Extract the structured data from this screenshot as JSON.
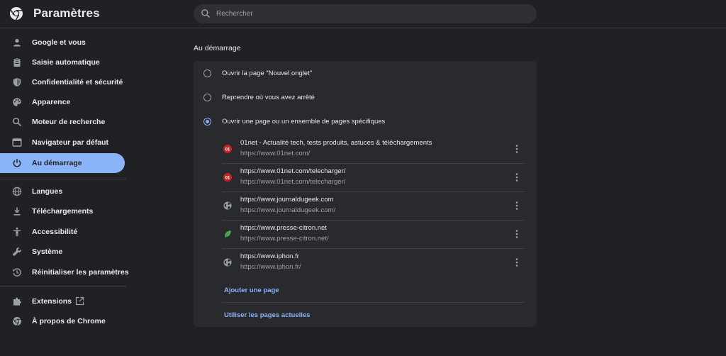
{
  "header": {
    "title": "Paramètres",
    "search_placeholder": "Rechercher"
  },
  "sidebar": {
    "items": [
      {
        "label": "Google et vous",
        "icon": "person-icon"
      },
      {
        "label": "Saisie automatique",
        "icon": "clipboard-icon"
      },
      {
        "label": "Confidentialité et sécurité",
        "icon": "shield-icon"
      },
      {
        "label": "Apparence",
        "icon": "palette-icon"
      },
      {
        "label": "Moteur de recherche",
        "icon": "search-icon"
      },
      {
        "label": "Navigateur par défaut",
        "icon": "browser-icon"
      },
      {
        "label": "Au démarrage",
        "icon": "power-icon",
        "active": true
      },
      {
        "label": "Langues",
        "icon": "globe-icon"
      },
      {
        "label": "Téléchargements",
        "icon": "download-icon"
      },
      {
        "label": "Accessibilité",
        "icon": "accessibility-icon"
      },
      {
        "label": "Système",
        "icon": "wrench-icon"
      },
      {
        "label": "Réinitialiser les paramètres",
        "icon": "restore-icon"
      },
      {
        "label": "Extensions",
        "icon": "puzzle-icon"
      },
      {
        "label": "À propos de Chrome",
        "icon": "chrome-icon"
      }
    ]
  },
  "main": {
    "section_title": "Au démarrage",
    "options": [
      {
        "label": "Ouvrir la page \"Nouvel onglet\"",
        "checked": false
      },
      {
        "label": "Reprendre où vous avez arrêté",
        "checked": false
      },
      {
        "label": "Ouvrir une page ou un ensemble de pages spécifiques",
        "checked": true
      }
    ],
    "pages": [
      {
        "title": "01net - Actualité tech, tests produits, astuces & téléchargements",
        "url": "https://www.01net.com/",
        "favicon": "01net-icon"
      },
      {
        "title": "https://www.01net.com/telecharger/",
        "url": "https://www.01net.com/telecharger/",
        "favicon": "01net-icon"
      },
      {
        "title": "https://www.journaldugeek.com",
        "url": "https://www.journaldugeek.com/",
        "favicon": "globe-icon"
      },
      {
        "title": "https://www.presse-citron.net",
        "url": "https://www.presse-citron.net/",
        "favicon": "leaf-icon"
      },
      {
        "title": "https://www.iphon.fr",
        "url": "https://www.iphon.fr/",
        "favicon": "globe-icon"
      }
    ],
    "add_page": "Ajouter une page",
    "use_current": "Utiliser les pages actuelles"
  },
  "colors": {
    "background": "#202124",
    "card": "#292a2d",
    "accent": "#8ab4f8",
    "text": "#e8eaed",
    "secondary_text": "#9aa0a6"
  }
}
